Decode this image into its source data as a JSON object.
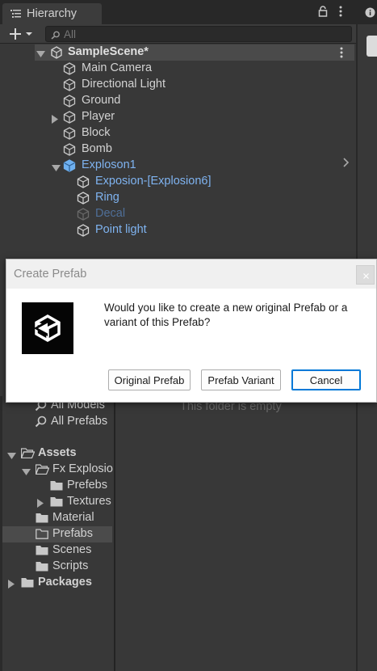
{
  "hierarchy": {
    "tab_title": "Hierarchy",
    "search_placeholder": "All",
    "scene_name": "SampleScene*",
    "items": [
      {
        "label": "Main Camera",
        "type": "object"
      },
      {
        "label": "Directional Light",
        "type": "object"
      },
      {
        "label": "Ground",
        "type": "object"
      },
      {
        "label": "Player",
        "type": "object",
        "collapsed": true
      },
      {
        "label": "Block",
        "type": "object"
      },
      {
        "label": "Bomb",
        "type": "object"
      },
      {
        "label": "Exploson1",
        "type": "prefab-root",
        "expanded": true
      },
      {
        "label": "Exposion-[Explosion6]",
        "type": "prefab-child"
      },
      {
        "label": "Ring",
        "type": "prefab-child"
      },
      {
        "label": "Decal",
        "type": "prefab-child-disabled"
      },
      {
        "label": "Point light",
        "type": "prefab-child"
      }
    ]
  },
  "dialog": {
    "title": "Create Prefab",
    "message": "Would you like to create a new original Prefab or a variant of this Prefab?",
    "buttons": {
      "original": "Original Prefab",
      "variant": "Prefab Variant",
      "cancel": "Cancel"
    }
  },
  "project": {
    "favorites": [
      "All Models",
      "All Prefabs"
    ],
    "empty_message": "This folder is empty",
    "folders": [
      {
        "label": "Assets",
        "level": 0
      },
      {
        "label": "Fx Explosion",
        "level": 1
      },
      {
        "label": "Prefebs",
        "level": 2
      },
      {
        "label": "Textures",
        "level": 2
      },
      {
        "label": "Material",
        "level": 1
      },
      {
        "label": "Prefabs",
        "level": 1,
        "selected": true
      },
      {
        "label": "Scenes",
        "level": 1
      },
      {
        "label": "Scripts",
        "level": 1
      },
      {
        "label": "Packages",
        "level": 0
      }
    ]
  },
  "colors": {
    "panel_bg": "#383838",
    "prefab_blue": "#7fb3f0",
    "prefab_disabled": "#4f6f98",
    "dialog_bg": "#ffffff",
    "accent": "#0078d7"
  }
}
